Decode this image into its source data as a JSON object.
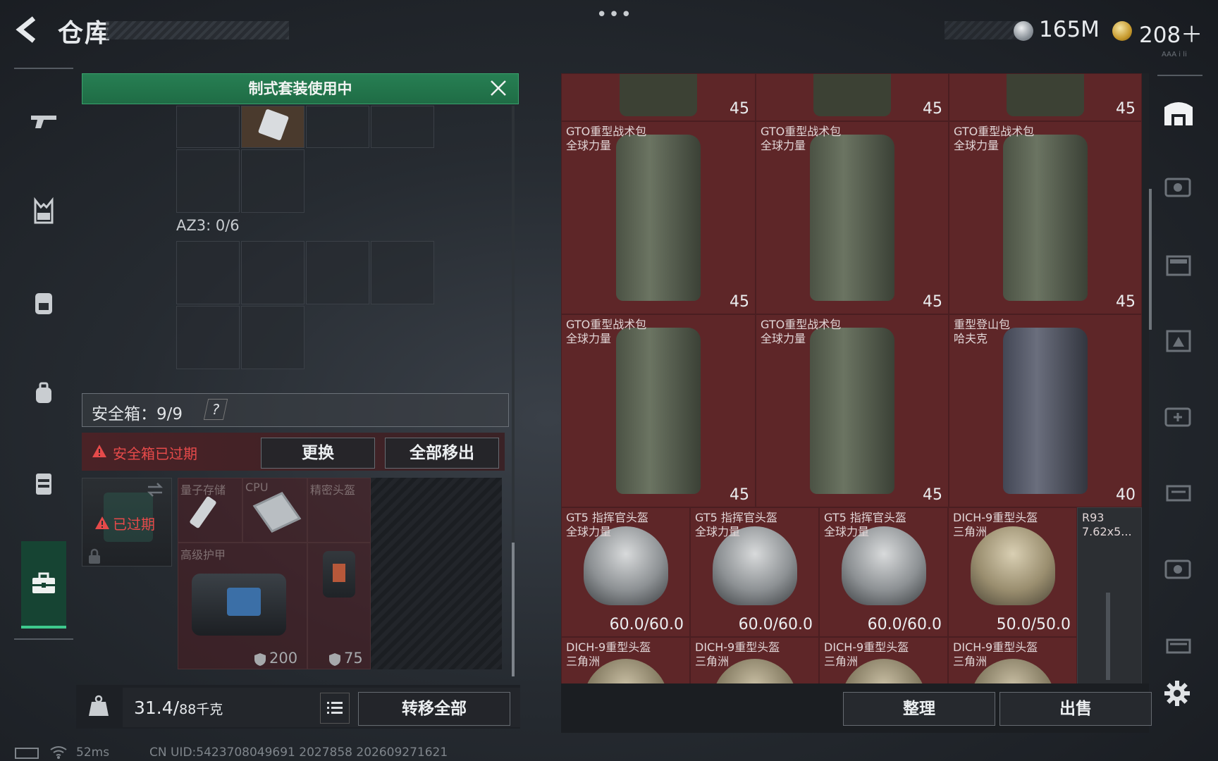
{
  "header": {
    "title": "仓库",
    "more": "•••",
    "currency_silver": "165M",
    "currency_gold": "208＋",
    "tiny_label": "AAA i li"
  },
  "sidebar": {
    "items": [
      {
        "name": "weapon"
      },
      {
        "name": "vest"
      },
      {
        "name": "backpack"
      },
      {
        "name": "pouch"
      },
      {
        "name": "case"
      },
      {
        "name": "toolbox"
      }
    ]
  },
  "loadout": {
    "banner": "制式套装使用中",
    "az3_label": "AZ3: 0/6",
    "safebox_label": "安全箱：9/9",
    "safebox_help": "?",
    "expired_warning": "安全箱已过期",
    "replace_button": "更换",
    "remove_all_button": "全部移出",
    "expired_box_label": "已过期",
    "slots": {
      "quantum": "量子存储",
      "cpu": "CPU",
      "precision_head": "精密头盔",
      "armor": "高级护甲"
    },
    "armor_values": [
      "200",
      "75"
    ]
  },
  "bottom": {
    "weight_value": "31.4/",
    "weight_max": "88千克",
    "transfer_all": "转移全部",
    "sort": "整理",
    "sell": "出售"
  },
  "status": {
    "ping": "52ms",
    "uid": "CN UID:5423708049691 2027858 202609271621"
  },
  "inventory": {
    "top_row": [
      {
        "value": "45"
      },
      {
        "value": "45"
      },
      {
        "value": "45"
      }
    ],
    "backpacks": [
      {
        "name": "GTO重型战术包\n全球力量",
        "value": "45"
      },
      {
        "name": "GTO重型战术包\n全球力量",
        "value": "45"
      },
      {
        "name": "GTO重型战术包\n全球力量",
        "value": "45"
      },
      {
        "name": "GTO重型战术包\n全球力量",
        "value": "45"
      },
      {
        "name": "GTO重型战术包\n全球力量",
        "value": "45"
      },
      {
        "name": "重型登山包\n哈夫克",
        "value": "40"
      }
    ],
    "helmets": [
      {
        "name": "GT5 指挥官头盔\n全球力量",
        "value": "60.0/60.0"
      },
      {
        "name": "GT5 指挥官头盔\n全球力量",
        "value": "60.0/60.0"
      },
      {
        "name": "GT5 指挥官头盔\n全球力量",
        "value": "60.0/60.0"
      },
      {
        "name": "DICH-9重型头盔\n三角洲",
        "value": "50.0/50.0"
      }
    ],
    "ammo": {
      "name": "R93\n7.62x5..."
    },
    "bottom_row": [
      {
        "name": "DICH-9重型头盔\n三角洲"
      },
      {
        "name": "DICH-9重型头盔\n三角洲"
      },
      {
        "name": "DICH-9重型头盔\n三角洲"
      },
      {
        "name": "DICH-9重型头盔\n三角洲"
      }
    ]
  },
  "colors": {
    "accent_green": "#277f53",
    "item_red": "#5e2628",
    "warning_red": "#e64a4a"
  }
}
